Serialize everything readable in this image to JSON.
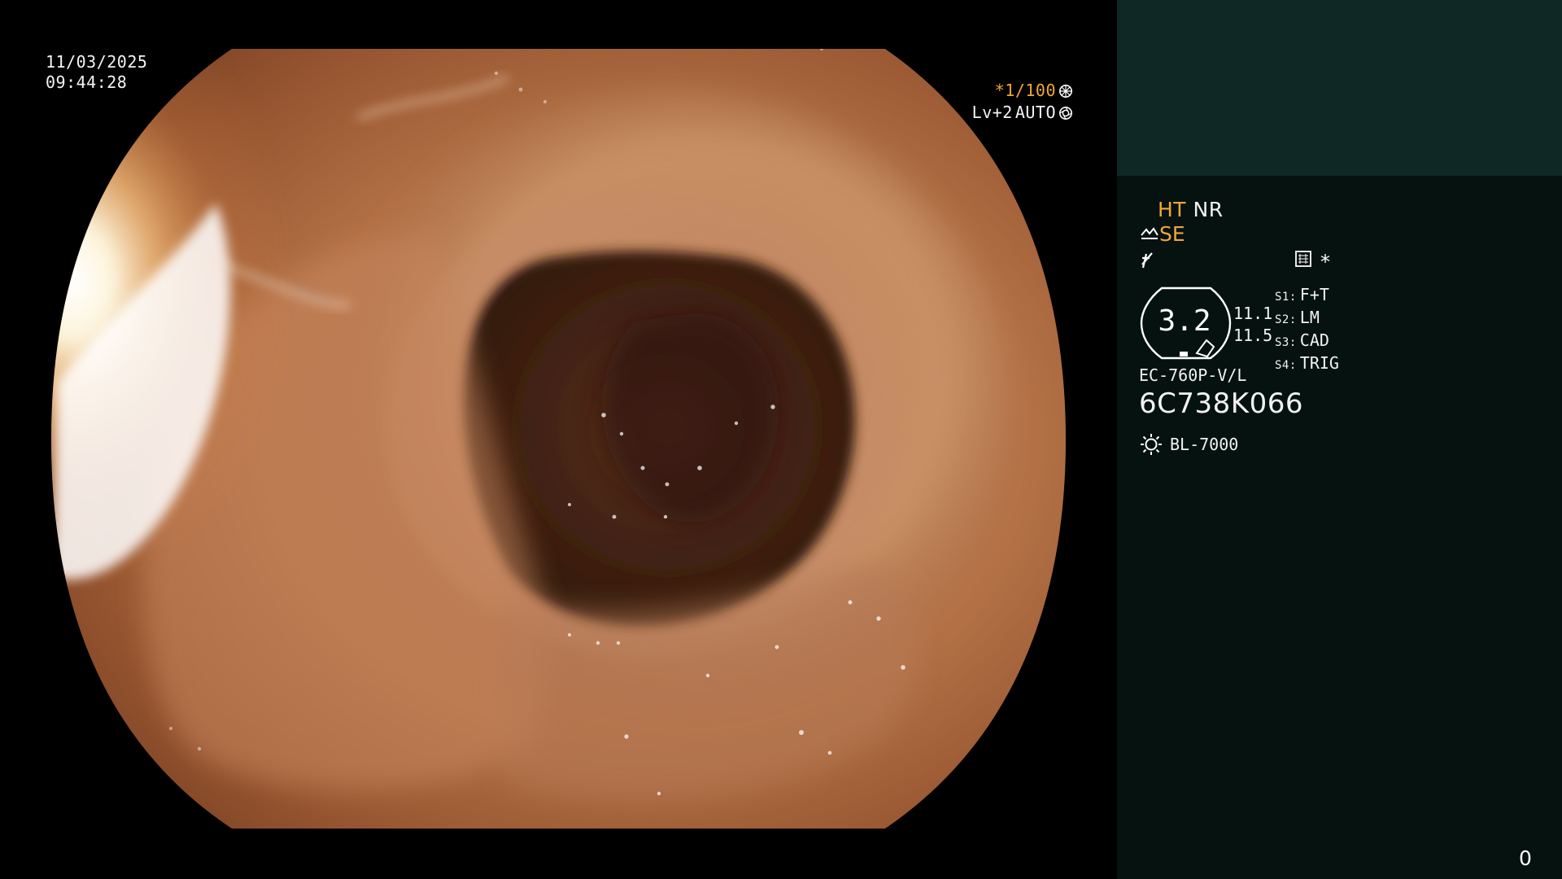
{
  "overlay": {
    "date": "11/03/2025",
    "time": "09:44:28",
    "shutter_speed": "*1/100",
    "level": "Lv+2",
    "iris_mode": "AUTO"
  },
  "panel": {
    "mode_ht": "HT",
    "mode_nr": "NR",
    "se": "SE",
    "asterisk": "*",
    "lens_value": "3.2",
    "side_value_top": "11.1",
    "side_value_bottom": "11.5",
    "switches": [
      {
        "key": "S1:",
        "value": "F+T"
      },
      {
        "key": "S2:",
        "value": "LM"
      },
      {
        "key": "S3:",
        "value": "CAD"
      },
      {
        "key": "S4:",
        "value": "TRIG"
      }
    ],
    "scope_model": "EC-760P-V/L",
    "scope_serial": "6C738K066",
    "light_source": "BL-7000",
    "counter": "0"
  },
  "colors": {
    "side_panel_bg": "#061210",
    "side_panel_top_bg": "#0f2725",
    "accent_orange": "#f0a63a",
    "text_white": "#f2f2f2"
  },
  "icons": {
    "shutter": "shutter-icon",
    "iris": "iris-icon",
    "structure": "structure-enhance-icon",
    "color_shift": "color-shift-icon",
    "menu": "menu-list-icon",
    "light": "light-source-icon"
  }
}
